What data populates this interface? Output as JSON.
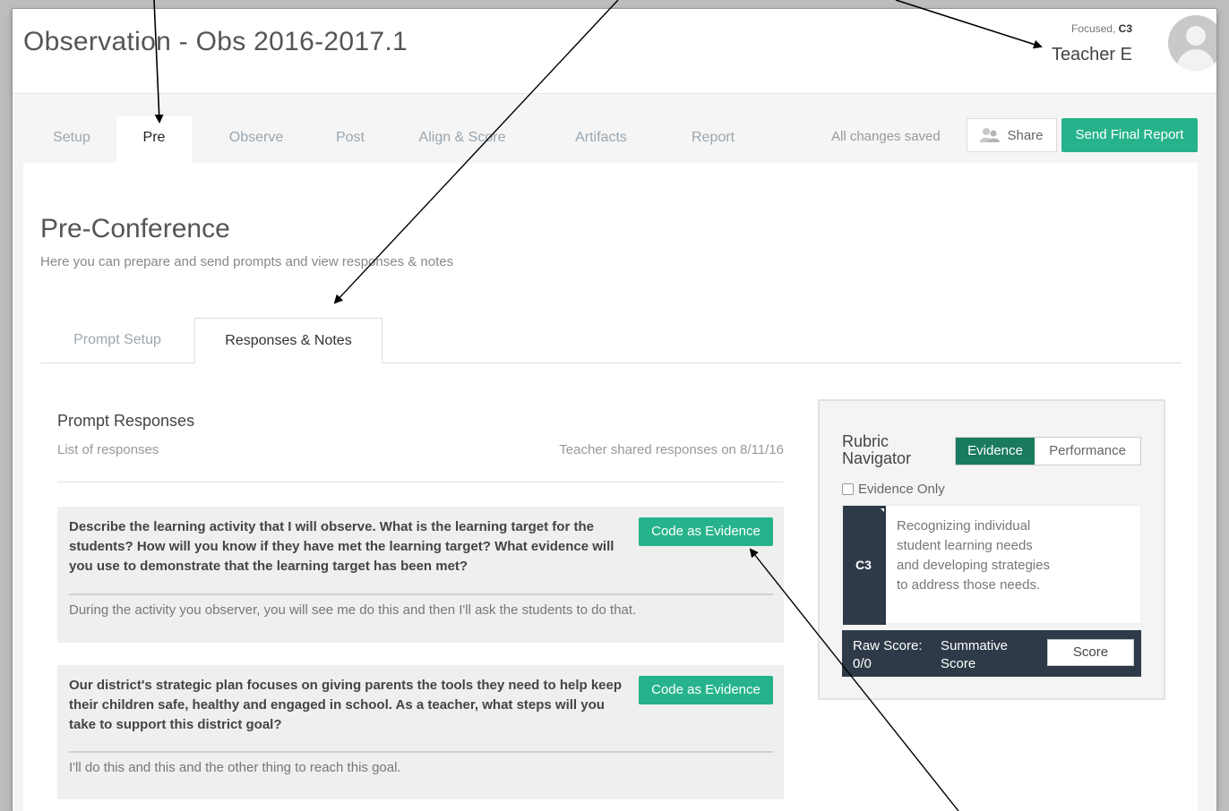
{
  "header": {
    "title": "Observation - Obs 2016-2017.1",
    "user_role_prefix": "Focused,",
    "user_role_code": "C3",
    "user_name": "Teacher E"
  },
  "main_tabs": [
    {
      "label": "Setup",
      "active": false
    },
    {
      "label": "Pre",
      "active": true
    },
    {
      "label": "Observe",
      "active": false
    },
    {
      "label": "Post",
      "active": false
    },
    {
      "label": "Align & Score",
      "active": false
    },
    {
      "label": "Artifacts",
      "active": false
    },
    {
      "label": "Report",
      "active": false
    }
  ],
  "toolbar": {
    "save_status": "All changes saved",
    "share_label": "Share",
    "send_report_label": "Send Final Report"
  },
  "section": {
    "title": "Pre-Conference",
    "subtitle": "Here you can prepare and send prompts and view responses & notes"
  },
  "sub_tabs": [
    {
      "label": "Prompt Setup",
      "active": false
    },
    {
      "label": "Responses & Notes",
      "active": true
    }
  ],
  "prompt_responses": {
    "heading": "Prompt Responses",
    "subheading": "List of responses",
    "shared_note": "Teacher shared responses on 8/11/16",
    "items": [
      {
        "question": "Describe the learning activity that I will observe. What is the learning target for the students? How will you know if they have met the learning target? What evidence will you use to demonstrate that the learning target has been met?",
        "answer": "During the activity you observer, you will see me do this and then I'll ask the students to do that.",
        "button_label": "Code as Evidence"
      },
      {
        "question": "Our district's strategic plan focuses on giving parents the tools they need to help keep their children safe, healthy and engaged in school. As a teacher, what steps will you take to support this district goal?",
        "answer": "I'll do this and this and the other thing to reach this goal.",
        "button_label": "Code as Evidence"
      }
    ]
  },
  "rubric_navigator": {
    "title": "Rubric Navigator",
    "toggle_evidence": "Evidence",
    "toggle_performance": "Performance",
    "evidence_only_label": "Evidence Only",
    "evidence_only_checked": false,
    "criterion_code": "C3",
    "criterion_description": "Recognizing individual student learning needs and developing strategies to address those needs.",
    "raw_score_label": "Raw Score: 0/0",
    "summative_label": "Summative Score",
    "score_button": "Score"
  },
  "colors": {
    "accent_green": "#26b38b",
    "dark_green": "#1a7a5f",
    "navy": "#2e3a48"
  }
}
